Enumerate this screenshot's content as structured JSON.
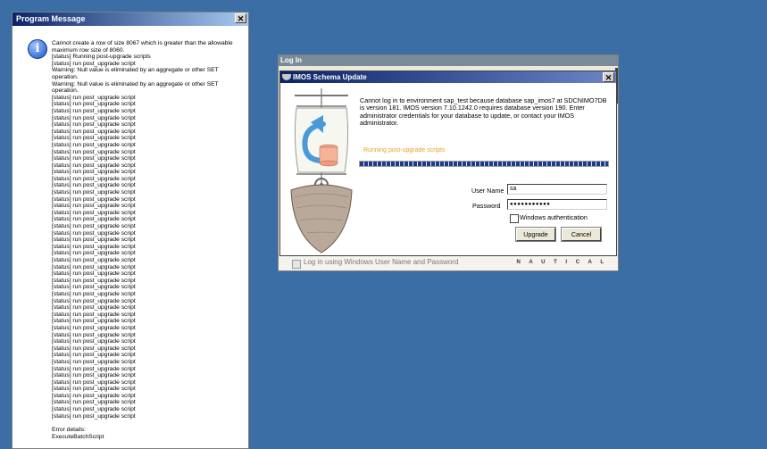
{
  "program_message": {
    "title": "Program Message",
    "close_label": "✕",
    "messages": [
      "Cannot create a row of size 8067 which is greater than the allowable maximum row size of 8060.",
      "[status] Running post-upgrade scripts",
      "[status] run post_upgrade script",
      "Warning: Null value is eliminated by an aggregate or other SET operation.",
      "Warning: Null value is eliminated by an aggregate or other SET operation.",
      "[status] run post_upgrade script",
      "[status] run post_upgrade script",
      "[status] run post_upgrade script",
      "[status] run post_upgrade script",
      "[status] run post_upgrade script",
      "[status] run post_upgrade script",
      "[status] run post_upgrade script",
      "[status] run post_upgrade script",
      "[status] run post_upgrade script",
      "[status] run post_upgrade script",
      "[status] run post_upgrade script",
      "[status] run post_upgrade script",
      "[status] run post_upgrade script",
      "[status] run post_upgrade script",
      "[status] run post_upgrade script",
      "[status] run post_upgrade script",
      "[status] run post_upgrade script",
      "[status] run post_upgrade script",
      "[status] run post_upgrade script",
      "[status] run post_upgrade script",
      "[status] run post_upgrade script",
      "[status] run post_upgrade script",
      "[status] run post_upgrade script",
      "[status] run post_upgrade script",
      "[status] run post_upgrade script",
      "[status] run post_upgrade script",
      "[status] run post_upgrade script",
      "[status] run post_upgrade script",
      "[status] run post_upgrade script",
      "[status] run post_upgrade script",
      "[status] run post_upgrade script",
      "[status] run post_upgrade script",
      "[status] run post_upgrade script",
      "[status] run post_upgrade script",
      "[status] run post_upgrade script",
      "[status] run post_upgrade script",
      "[status] run post_upgrade script",
      "[status] run post_upgrade script",
      "[status] run post_upgrade script",
      "[status] run post_upgrade script",
      "[status] run post_upgrade script",
      "[status] run post_upgrade script",
      "[status] run post_upgrade script",
      "[status] run post_upgrade script",
      "[status] run post_upgrade script",
      "[status] run post_upgrade script",
      "[status] run post_upgrade script",
      "[status] run post_upgrade script"
    ],
    "error_details_label": "Error details:",
    "error_details_value": "ExecuteBatchScript"
  },
  "login": {
    "title": "Log In",
    "windows_login_label": "Log in using Windows User Name and Password",
    "brand": "N A U T I C A L"
  },
  "schema_dialog": {
    "title": "IMOS Schema Update",
    "close_label": "✕",
    "message": "Cannot log in to environment sap_test because database sap_imos7 at SDCNIMO7DB is version 181. IMOS version 7.10.1242.0 requires database version 190. Enter administrator credentials for your database to update, or contact your IMOS administrator.",
    "status": "Running post-upgrade scripts",
    "progress": 1.0,
    "username_label": "User Name",
    "username_value": "sa",
    "password_label": "Password",
    "password_value": "●●●●●●●●●●●",
    "windows_auth_label": "Windows authentication",
    "upgrade_label": "Upgrade",
    "cancel_label": "Cancel"
  }
}
